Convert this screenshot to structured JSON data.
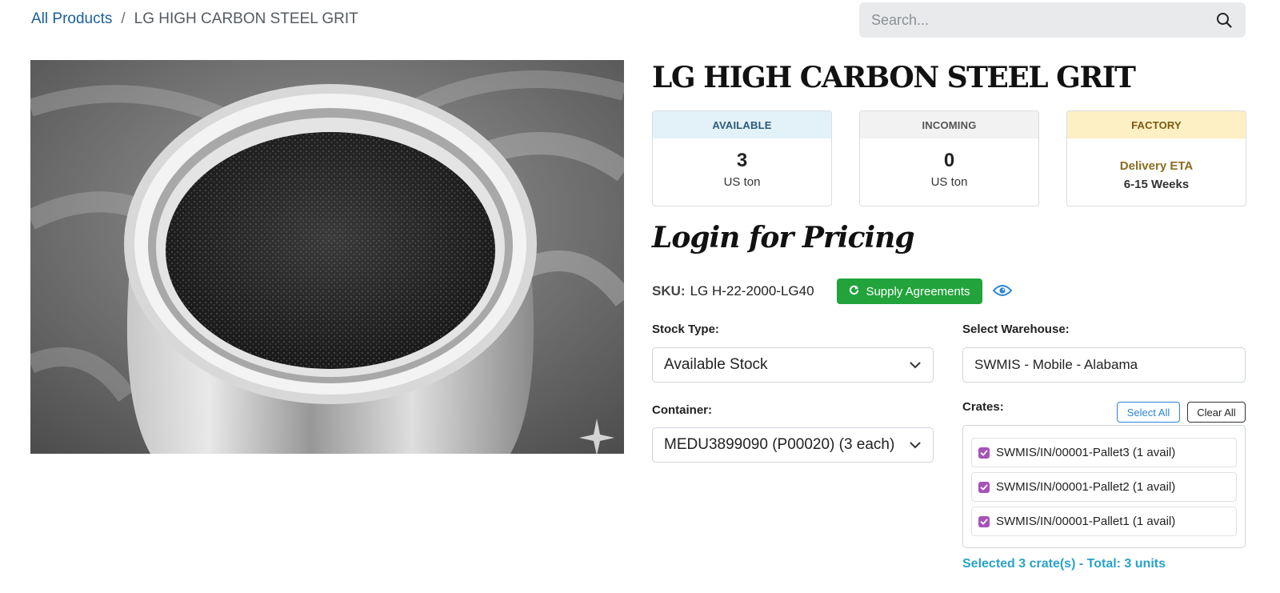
{
  "breadcrumb": {
    "root": "All Products",
    "separator": "/",
    "current": "LG HIGH CARBON STEEL GRIT"
  },
  "search": {
    "placeholder": "Search...",
    "value": ""
  },
  "product": {
    "title": "LG HIGH CARBON STEEL GRIT",
    "image_alt": "jar of steel grit"
  },
  "stock_cards": {
    "available": {
      "label": "AVAILABLE",
      "value": "3",
      "unit": "US ton"
    },
    "incoming": {
      "label": "INCOMING",
      "value": "0",
      "unit": "US ton"
    },
    "factory": {
      "label": "FACTORY",
      "eta_label": "Delivery ETA",
      "eta_value": "6-15 Weeks"
    }
  },
  "pricing": {
    "login_text": "Login for Pricing"
  },
  "sku": {
    "label": "SKU:",
    "value": "LG H-22-2000-LG40"
  },
  "actions": {
    "supply_agreements": "Supply Agreements"
  },
  "form": {
    "stock_type": {
      "label": "Stock Type:",
      "value": "Available Stock"
    },
    "warehouse": {
      "label": "Select Warehouse:",
      "value": "SWMIS - Mobile - Alabama"
    },
    "container": {
      "label": "Container:",
      "value": "MEDU3899090 (P00020) (3 each)"
    },
    "crates": {
      "label": "Crates:",
      "select_all": "Select All",
      "clear_all": "Clear All",
      "items": [
        {
          "label": "SWMIS/IN/00001-Pallet3 (1 avail)",
          "checked": true
        },
        {
          "label": "SWMIS/IN/00001-Pallet2 (1 avail)",
          "checked": true
        },
        {
          "label": "SWMIS/IN/00001-Pallet1 (1 avail)",
          "checked": true
        }
      ],
      "summary": "Selected 3 crate(s) - Total: 3 units"
    }
  },
  "colors": {
    "link": "#1a5e9a",
    "success": "#22a33b",
    "eye_icon": "#2c84d8",
    "checkbox": "#a553b8",
    "summary": "#2aa2c8"
  }
}
